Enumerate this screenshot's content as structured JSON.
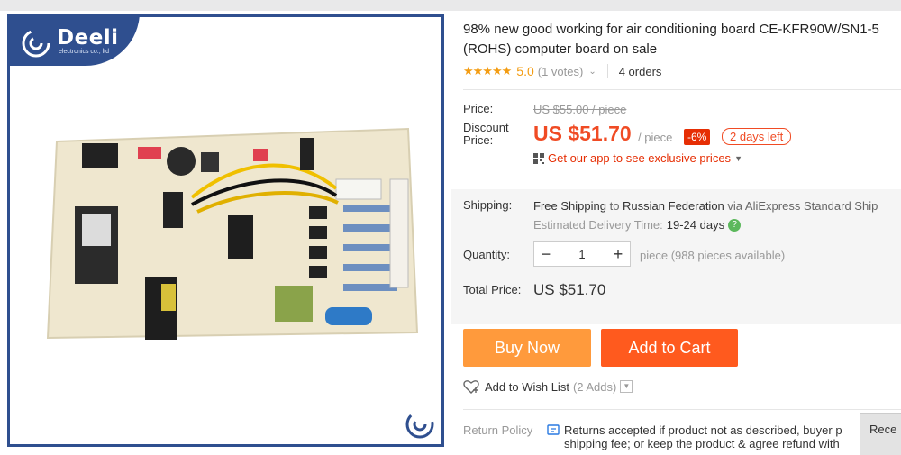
{
  "brand": {
    "name": "Deeli",
    "tagline": "electronics co., ltd"
  },
  "product": {
    "title_line1": "98% new good working for air conditioning board CE-KFR90W/SN1-5",
    "title_line2": "(ROHS) computer board on sale",
    "stars": "★★★★★",
    "rating": "5.0",
    "votes": "(1 votes)",
    "orders": "4 orders"
  },
  "price": {
    "price_label": "Price:",
    "original": "US $55.00 / piece",
    "discount_label": "Discount Price:",
    "current": "US $51.70",
    "unit": "/ piece",
    "discount_badge": "-6%",
    "days_left": "2 days left",
    "app_promo": "Get our app to see exclusive prices"
  },
  "shipping": {
    "label": "Shipping:",
    "free": "Free Shipping",
    "to": "to",
    "destination": "Russian Federation",
    "via": "via AliExpress Standard Ship",
    "est_label": "Estimated Delivery Time:",
    "est_days": "19-24 days"
  },
  "quantity": {
    "label": "Quantity:",
    "value": "1",
    "available": "piece (988 pieces available)"
  },
  "total": {
    "label": "Total Price:",
    "value": "US $51.70"
  },
  "actions": {
    "buy_now": "Buy Now",
    "add_to_cart": "Add to Cart",
    "wish_list": "Add to Wish List",
    "wish_count": "(2 Adds)"
  },
  "return_policy": {
    "label": "Return Policy",
    "line1": "Returns accepted if product not as described, buyer p",
    "line2": "shipping fee; or keep the product & agree refund with"
  },
  "recent_tab": "Rece",
  "colors": {
    "accent": "#f04b24",
    "buy": "#ff9a3c",
    "cart": "#ff5a1e",
    "frame": "#2f4f8f"
  },
  "icons": [
    "star-icon",
    "chevron-down-icon",
    "qr-code-icon",
    "check-circle-icon",
    "heart-icon",
    "return-policy-icon",
    "deeli-logo-icon"
  ]
}
